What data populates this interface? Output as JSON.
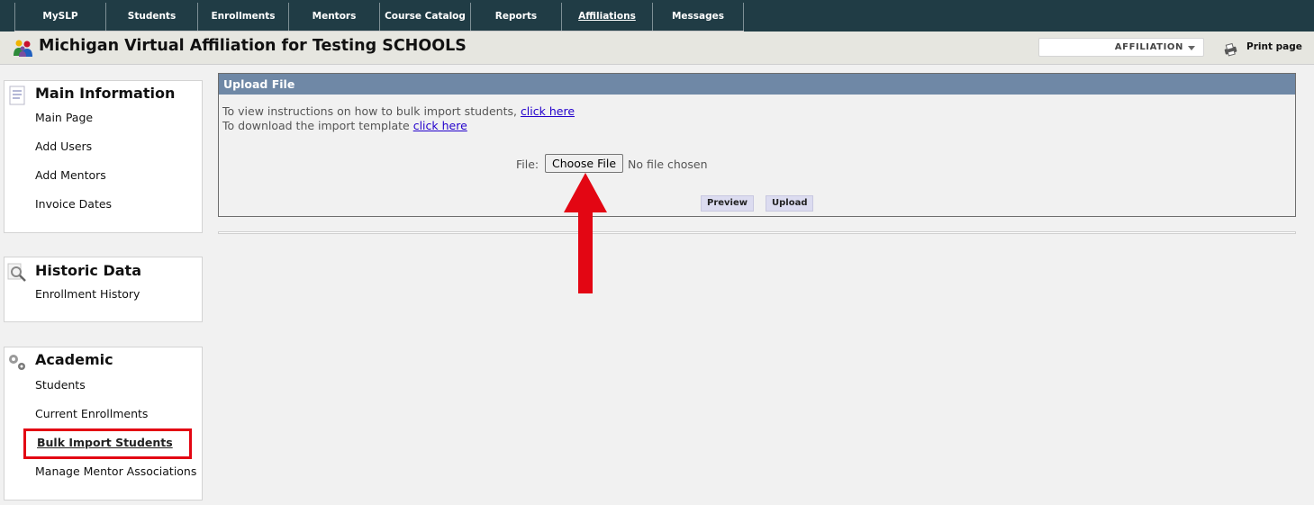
{
  "nav": {
    "tabs": [
      {
        "label": "MySLP"
      },
      {
        "label": "Students"
      },
      {
        "label": "Enrollments"
      },
      {
        "label": "Mentors"
      },
      {
        "label": "Course Catalog"
      },
      {
        "label": "Reports"
      },
      {
        "label": "Affiliations",
        "active": true
      },
      {
        "label": "Messages"
      }
    ]
  },
  "header": {
    "title": "Michigan Virtual Affiliation for Testing SCHOOLS",
    "affiliation_select": "AFFILIATION",
    "print_label": "Print page"
  },
  "sidebar": {
    "main_information": {
      "title": "Main Information",
      "items": [
        "Main Page",
        "Add Users",
        "Add Mentors",
        "Invoice Dates"
      ]
    },
    "historic_data": {
      "title": "Historic Data",
      "items": [
        "Enrollment History"
      ]
    },
    "academic": {
      "title": "Academic",
      "items": [
        "Students",
        "Current Enrollments",
        "Bulk Import Students",
        "Manage Mentor Associations"
      ]
    }
  },
  "upload": {
    "heading": "Upload File",
    "instructions_text": "To view instructions on how to bulk import students,",
    "instructions_link": "click here",
    "template_text": "To download the import template",
    "template_link": "click here",
    "file_label": "File:",
    "choose_file": "Choose File",
    "file_status": "No file chosen",
    "preview_button": "Preview",
    "upload_button": "Upload"
  },
  "colors": {
    "nav_bg": "#203c45",
    "panel_header_bg": "#6f88a6",
    "annotation_red": "#e30613"
  },
  "icons": {
    "title": "affiliation-people-icon",
    "print": "print-icon",
    "main_information": "document-list-icon",
    "historic_data": "magnifier-icon",
    "academic": "gears-icon",
    "annotation": "red-arrow-up-icon"
  }
}
